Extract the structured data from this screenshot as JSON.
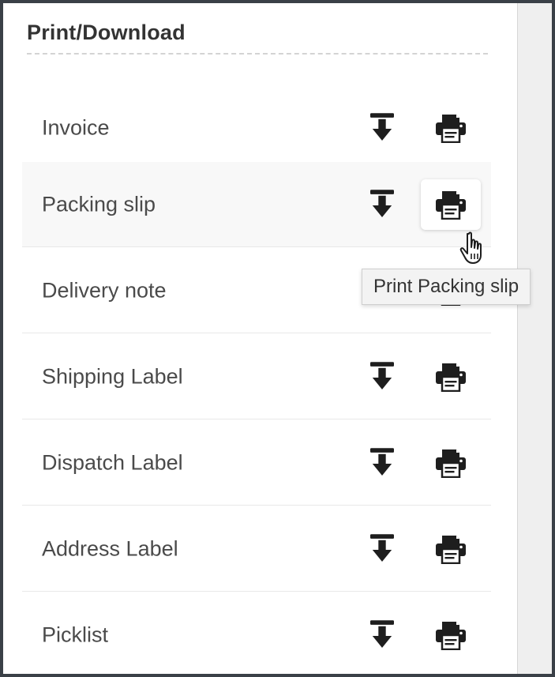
{
  "panel": {
    "title": "Print/Download"
  },
  "rows": [
    {
      "label": "Invoice",
      "download_icon": "download-icon",
      "print_icon": "printer-icon"
    },
    {
      "label": "Packing slip",
      "download_icon": "download-icon",
      "print_icon": "printer-icon"
    },
    {
      "label": "Delivery note",
      "download_icon": "download-icon",
      "print_icon": "printer-icon"
    },
    {
      "label": "Shipping Label",
      "download_icon": "download-icon",
      "print_icon": "printer-icon"
    },
    {
      "label": "Dispatch Label",
      "download_icon": "download-icon",
      "print_icon": "printer-icon"
    },
    {
      "label": "Address Label",
      "download_icon": "download-icon",
      "print_icon": "printer-icon"
    },
    {
      "label": "Picklist",
      "download_icon": "download-icon",
      "print_icon": "printer-icon"
    }
  ],
  "tooltip": {
    "text": "Print Packing slip"
  },
  "colors": {
    "text": "#4a4a4a",
    "title": "#333333",
    "icon": "#1e1e1e",
    "hover_row": "#f8f8f8",
    "border": "#e8e8e8"
  }
}
